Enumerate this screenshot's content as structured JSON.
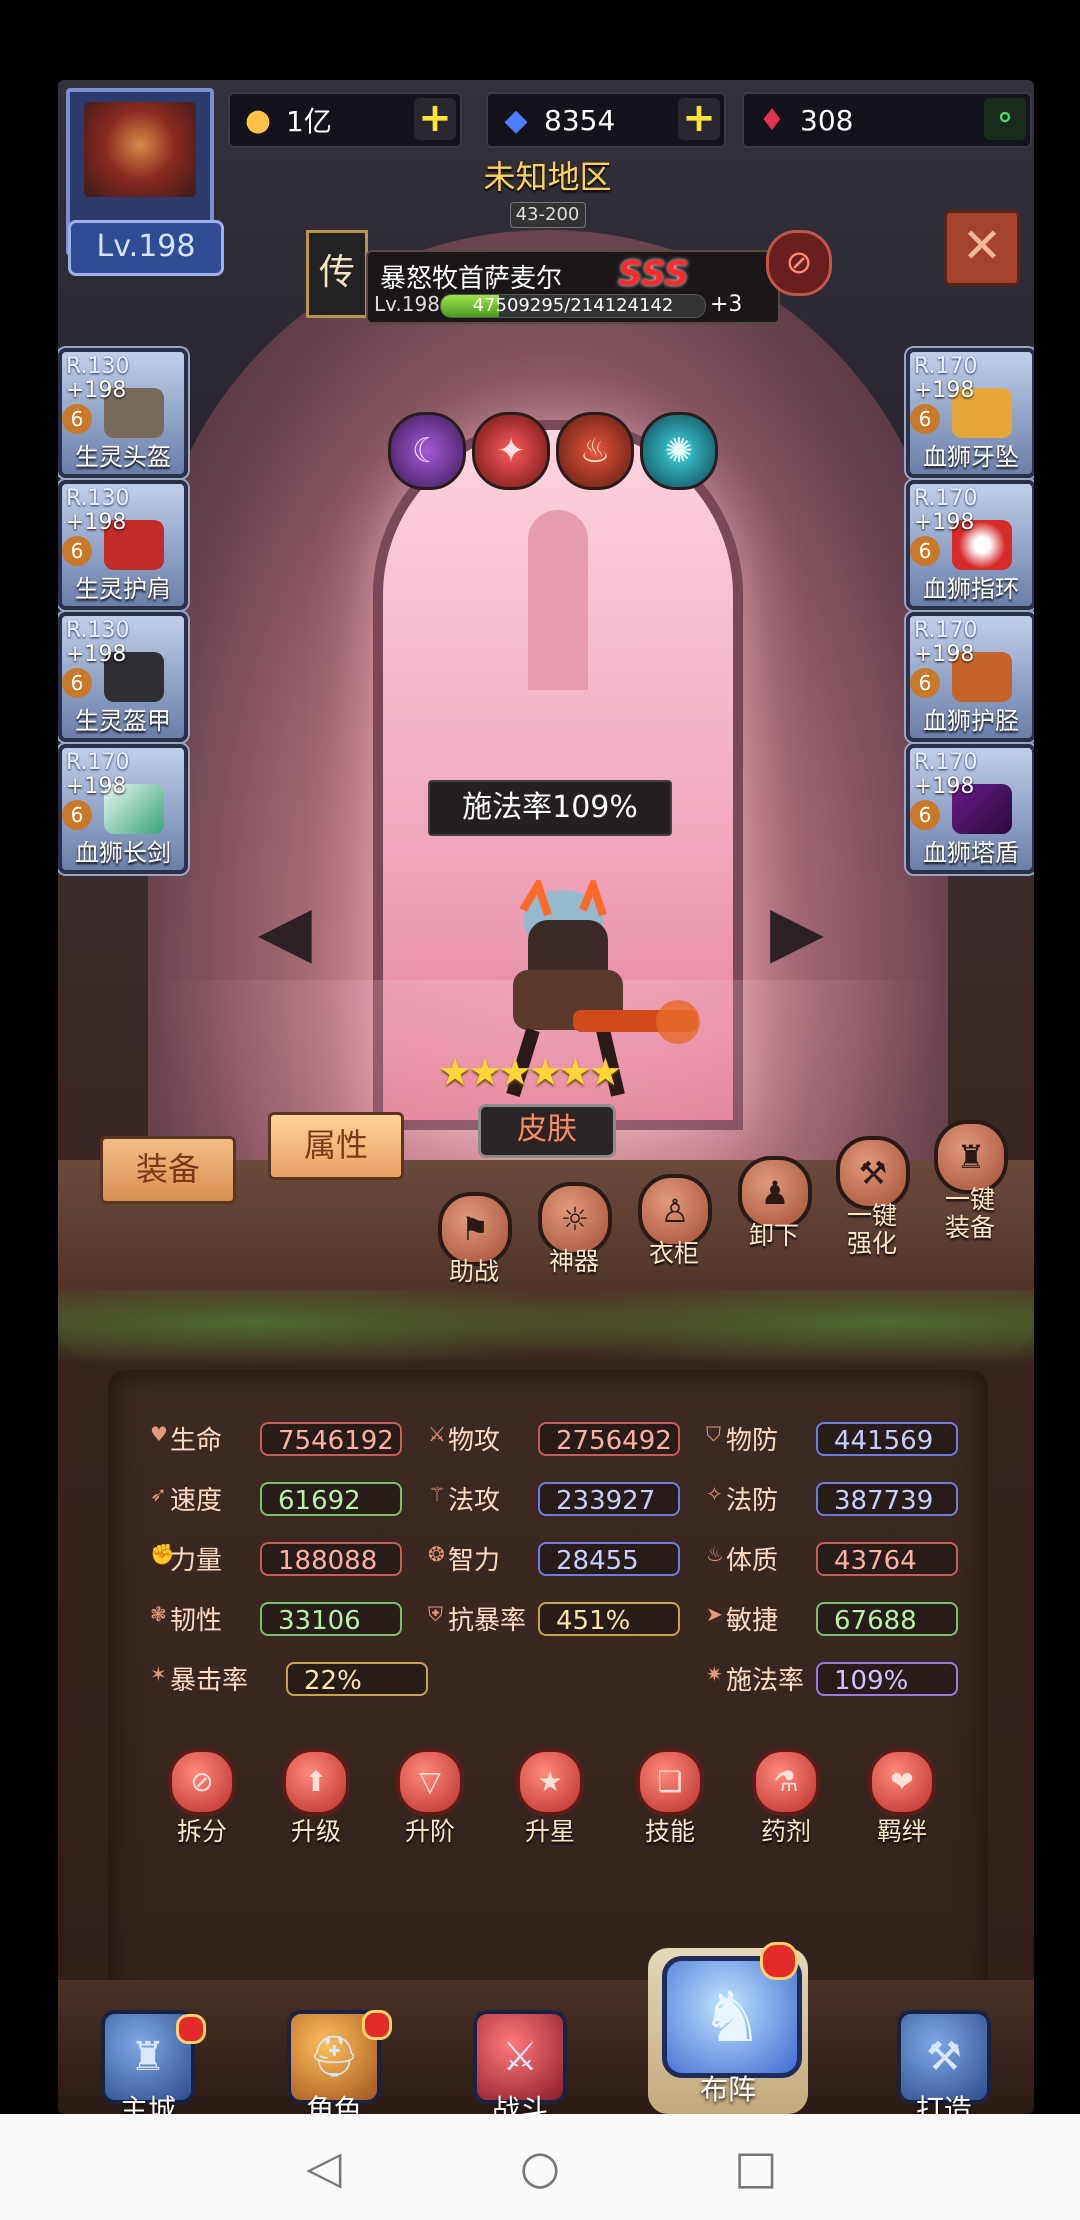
{
  "topbar": {
    "gold": {
      "icon": "gold-coin-icon",
      "value": "1亿"
    },
    "diamond": {
      "icon": "diamond-icon",
      "value": "8354"
    },
    "crystal": {
      "icon": "red-crystal-icon",
      "value": "308"
    }
  },
  "player": {
    "level": "Lv.198"
  },
  "region": {
    "name": "未知地区",
    "stage": "43-200"
  },
  "hero": {
    "rank_badge": "传",
    "name": "暴怒牧首萨麦尔",
    "grade": "SSS",
    "level": "Lv.198",
    "exp_text": "47509295/214124142",
    "exp_fraction": 0.22,
    "plus": "+3",
    "stars": "★★★★★★",
    "cast_banner": "施法率109%"
  },
  "skills": [
    "purple-claw-skill-icon",
    "red-demon-skill-icon",
    "red-flame-skill-icon",
    "cyan-aura-skill-icon"
  ],
  "equipment_left": [
    {
      "r": "R.130",
      "level": "+198",
      "tier": "6",
      "name": "生灵头盔"
    },
    {
      "r": "R.130",
      "level": "+198",
      "tier": "6",
      "name": "生灵护肩"
    },
    {
      "r": "R.130",
      "level": "+198",
      "tier": "6",
      "name": "生灵盔甲"
    },
    {
      "r": "R.170",
      "level": "+198",
      "tier": "6",
      "name": "血狮长剑"
    }
  ],
  "equipment_right": [
    {
      "r": "R.170",
      "level": "+198",
      "tier": "6",
      "name": "血狮牙坠"
    },
    {
      "r": "R.170",
      "level": "+198",
      "tier": "6",
      "name": "血狮指环"
    },
    {
      "r": "R.170",
      "level": "+198",
      "tier": "6",
      "name": "血狮护胫"
    },
    {
      "r": "R.170",
      "level": "+198",
      "tier": "6",
      "name": "血狮塔盾"
    }
  ],
  "skin_button": "皮肤",
  "tabs": {
    "equip": "装备",
    "attributes": "属性"
  },
  "actions": [
    {
      "label": "助战"
    },
    {
      "label": "神器"
    },
    {
      "label": "衣柜"
    },
    {
      "label": "卸下"
    },
    {
      "label": "一键\n强化"
    },
    {
      "label": "一键\n装备"
    }
  ],
  "stats": [
    {
      "name": "生命",
      "value": "7546192"
    },
    {
      "name": "物攻",
      "value": "2756492"
    },
    {
      "name": "物防",
      "value": "441569"
    },
    {
      "name": "速度",
      "value": "61692"
    },
    {
      "name": "法攻",
      "value": "233927"
    },
    {
      "name": "法防",
      "value": "387739"
    },
    {
      "name": "力量",
      "value": "188088"
    },
    {
      "name": "智力",
      "value": "28455"
    },
    {
      "name": "体质",
      "value": "43764"
    },
    {
      "name": "韧性",
      "value": "33106"
    },
    {
      "name": "抗暴率",
      "value": "451%"
    },
    {
      "name": "敏捷",
      "value": "67688"
    },
    {
      "name": "暴击率",
      "value": "22%"
    },
    {
      "name": "施法率",
      "value": "109%"
    }
  ],
  "functions": [
    {
      "label": "拆分"
    },
    {
      "label": "升级"
    },
    {
      "label": "升阶"
    },
    {
      "label": "升星"
    },
    {
      "label": "技能"
    },
    {
      "label": "药剂"
    },
    {
      "label": "羁绊"
    }
  ],
  "bottom_nav": [
    {
      "label": "主城"
    },
    {
      "label": "角色"
    },
    {
      "label": "战斗"
    },
    {
      "label": "布阵"
    },
    {
      "label": "打造"
    }
  ]
}
